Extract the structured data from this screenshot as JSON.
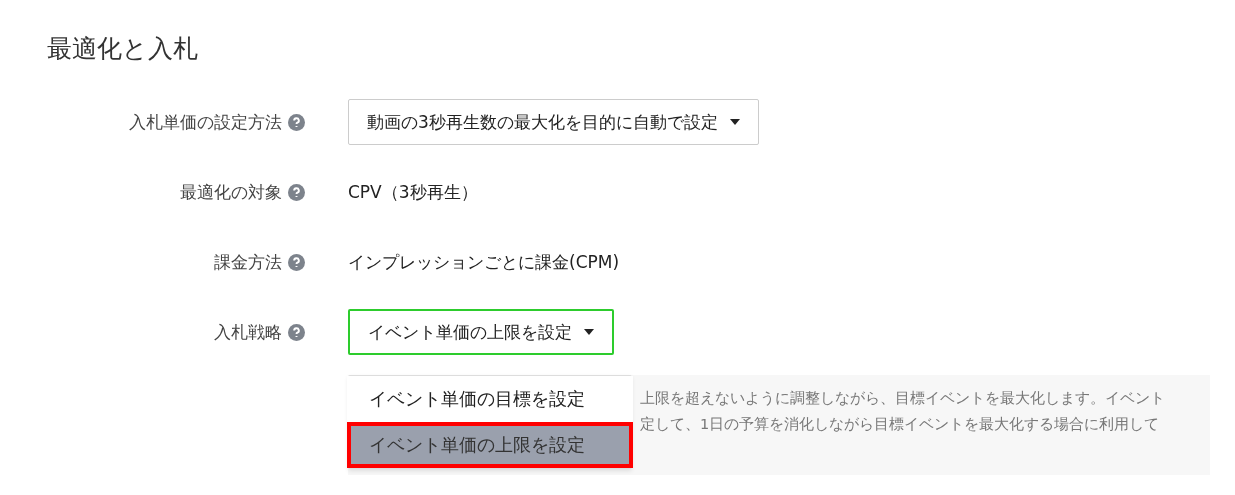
{
  "heading": "最適化と入札",
  "rows": [
    {
      "label": "入札単価の設定方法",
      "kind": "select",
      "value": "動画の3秒再生数の最大化を目的に自動で設定",
      "focused": false
    },
    {
      "label": "最適化の対象",
      "kind": "text",
      "value": "CPV（3秒再生）"
    },
    {
      "label": "課金方法",
      "kind": "text",
      "value": "インプレッションごとに課金(CPM)"
    },
    {
      "label": "入札戦略",
      "kind": "select",
      "value": "イベント単価の上限を設定",
      "focused": true
    }
  ],
  "menu": {
    "options": [
      {
        "label": "イベント単価の目標を設定",
        "selected": false,
        "highlighted": false
      },
      {
        "label": "イベント単価の上限を設定",
        "selected": true,
        "highlighted": true
      }
    ]
  },
  "help_lines": [
    "上限を超えないように調整しながら、目標イベントを最大化します。イベント",
    "定して、1日の予算を消化しながら目標イベントを最大化する場合に利用して"
  ]
}
